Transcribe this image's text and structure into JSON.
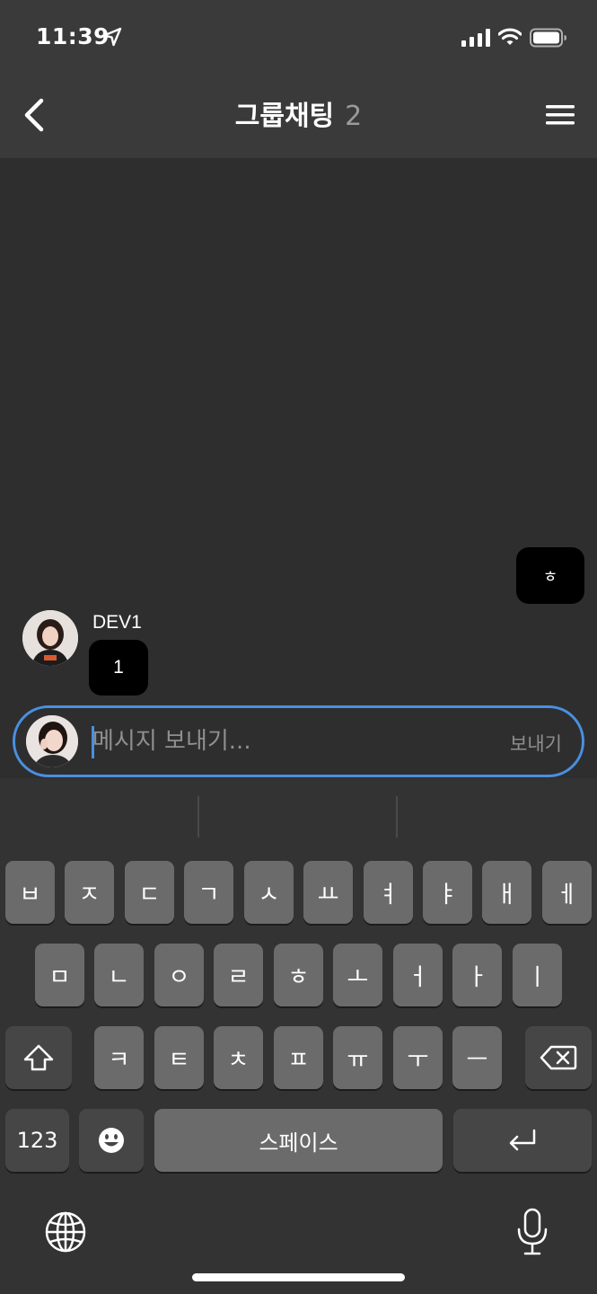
{
  "status_bar": {
    "time": "11:39",
    "icons": [
      "location-arrow-icon",
      "cellular-signal-icon",
      "wifi-icon",
      "battery-icon"
    ]
  },
  "header": {
    "title": "그룹채팅",
    "member_count": "2",
    "back_icon": "chevron-left-icon",
    "menu_icon": "hamburger-menu-icon"
  },
  "messages": [
    {
      "side": "mine",
      "text": "ㅎ"
    },
    {
      "side": "other",
      "sender": "DEV1",
      "text": "1"
    }
  ],
  "composer": {
    "placeholder": "메시지 보내기...",
    "value": "",
    "send_label": "보내기"
  },
  "keyboard": {
    "row1": [
      "ㅂ",
      "ㅈ",
      "ㄷ",
      "ㄱ",
      "ㅅ",
      "ㅛ",
      "ㅕ",
      "ㅑ",
      "ㅐ",
      "ㅔ"
    ],
    "row2": [
      "ㅁ",
      "ㄴ",
      "ㅇ",
      "ㄹ",
      "ㅎ",
      "ㅗ",
      "ㅓ",
      "ㅏ",
      "ㅣ"
    ],
    "row3": [
      "ㅋ",
      "ㅌ",
      "ㅊ",
      "ㅍ",
      "ㅠ",
      "ㅜ",
      "ㅡ"
    ],
    "numbers_label": "123",
    "space_label": "스페이스",
    "icons": [
      "shift-icon",
      "backspace-icon",
      "emoji-icon",
      "return-icon",
      "globe-icon",
      "microphone-icon"
    ]
  },
  "colors": {
    "accent": "#4a8fe0",
    "background": "#2e2e2e",
    "header": "#3a3a3a",
    "bubble": "#000000",
    "key": "#6b6b6b",
    "key_dark": "#464646"
  }
}
